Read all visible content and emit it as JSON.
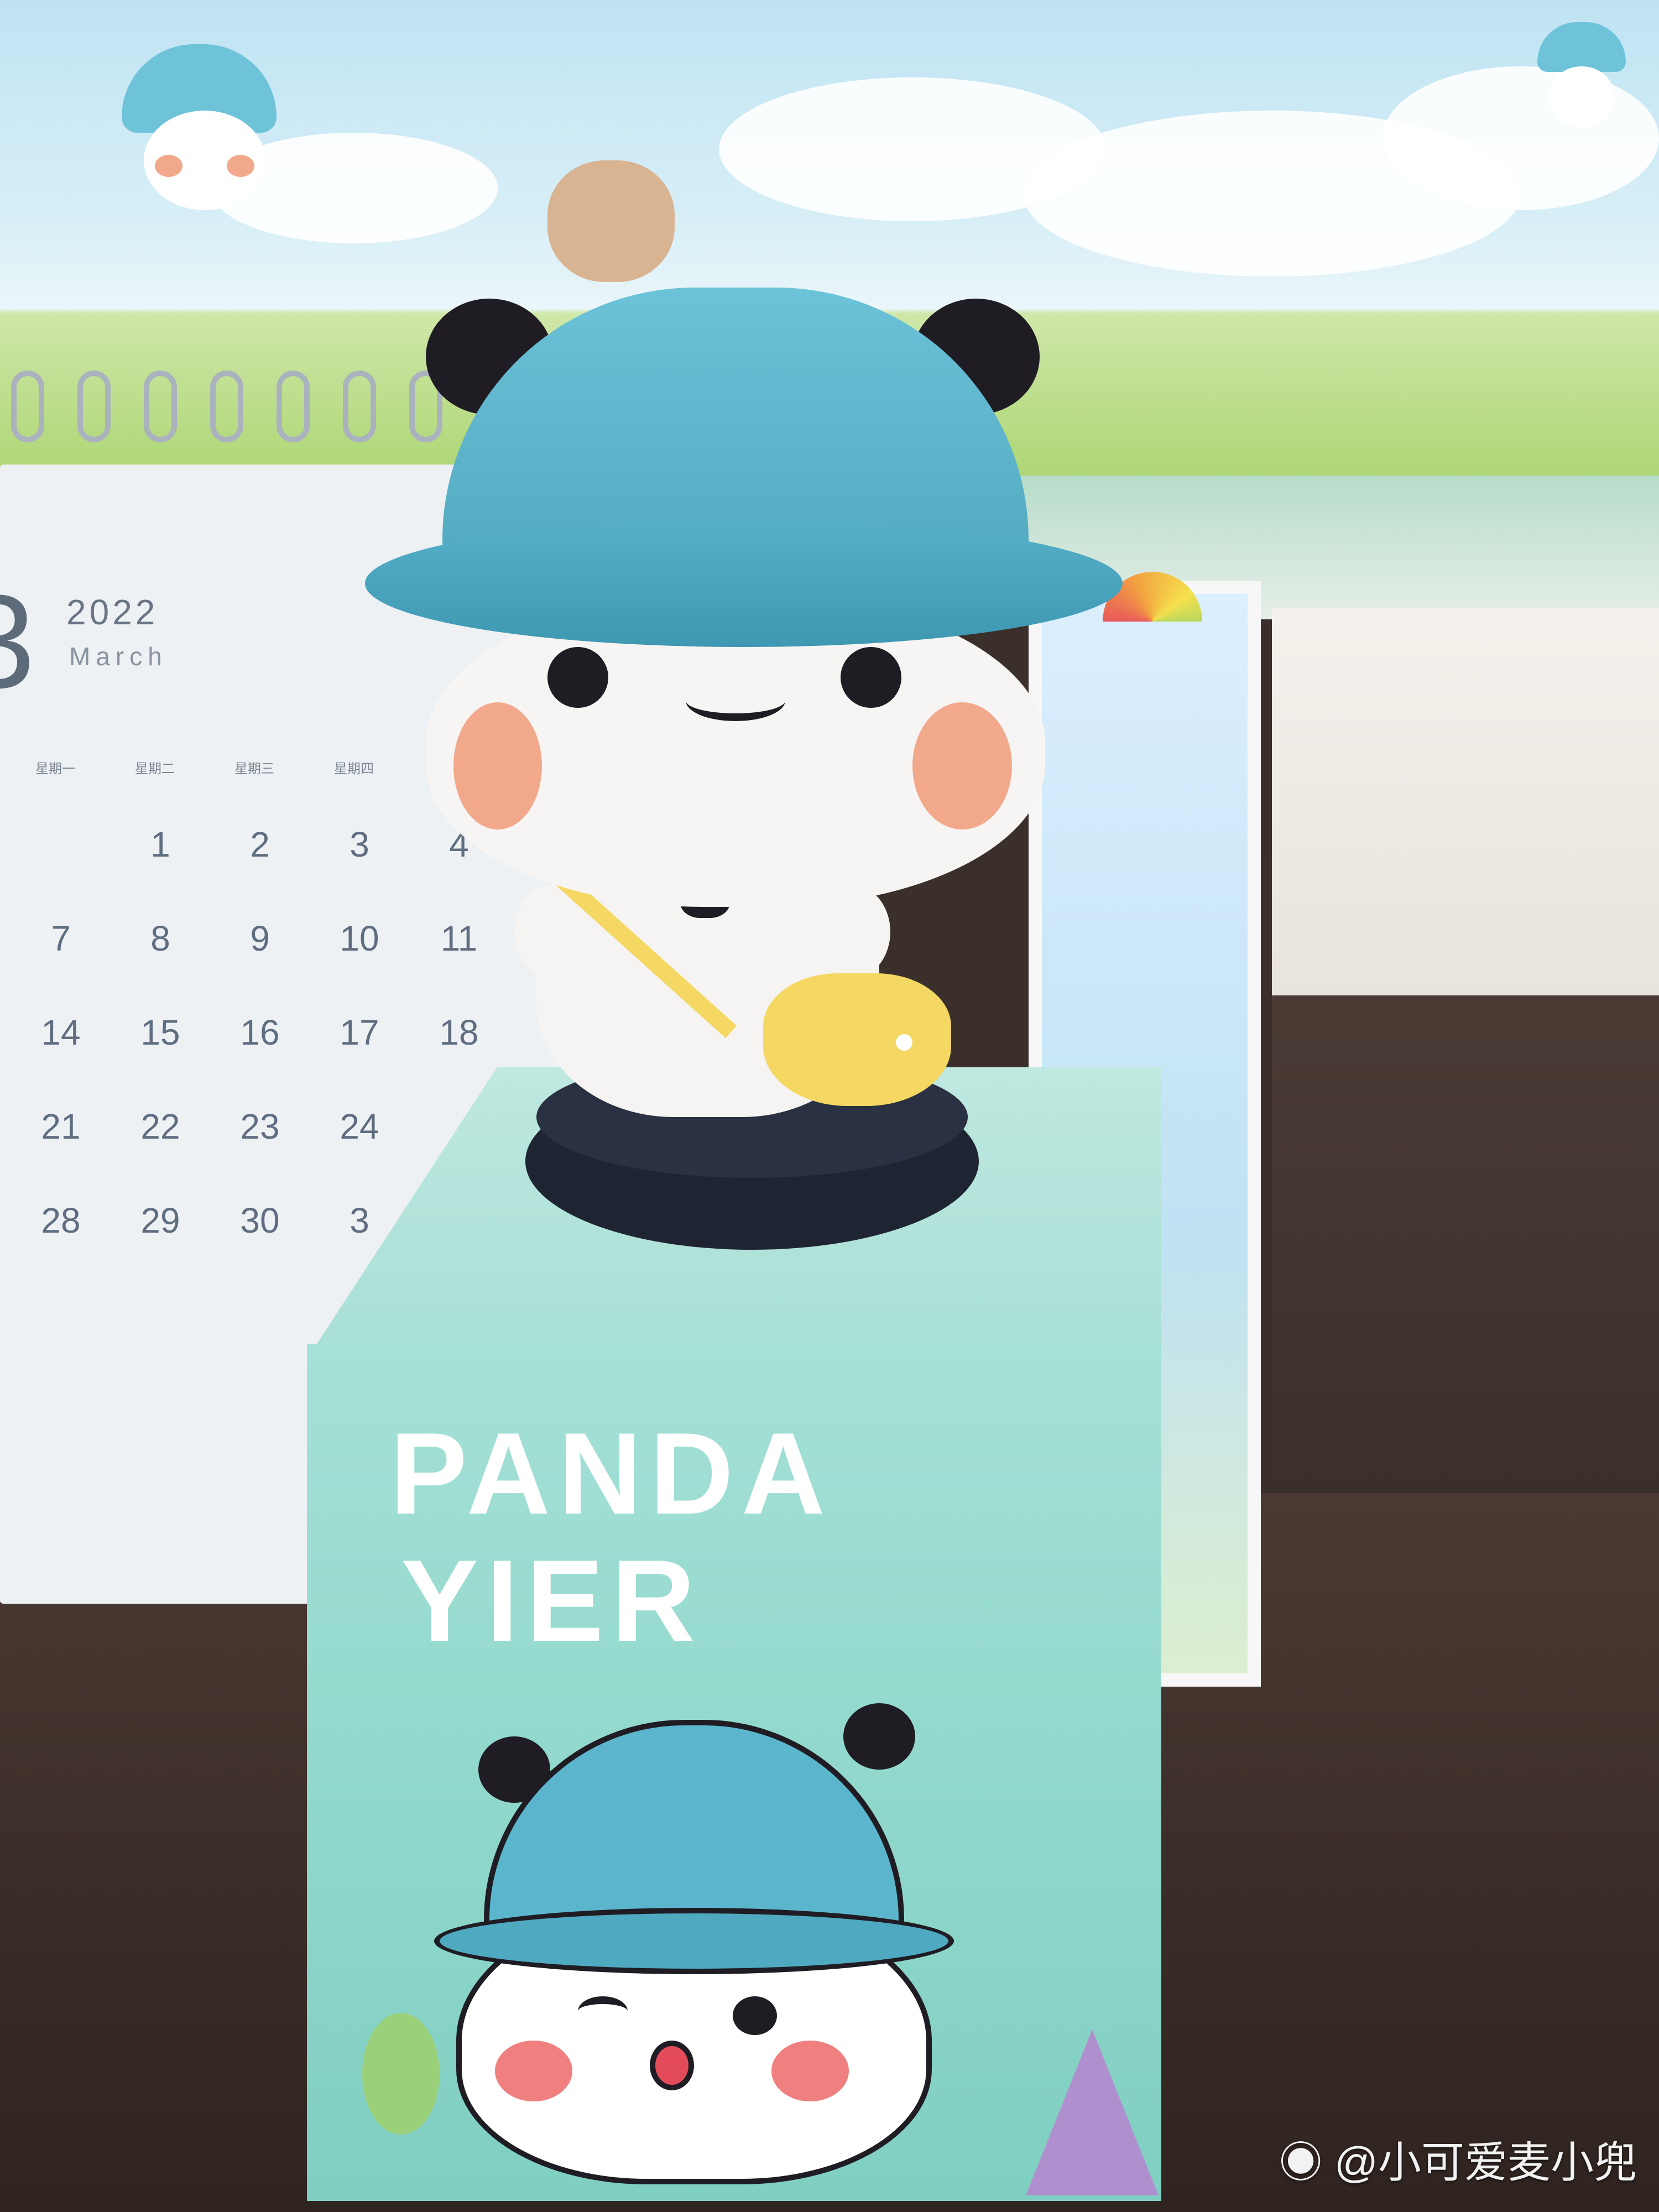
{
  "calendar": {
    "big_digit": "3",
    "year": "2022",
    "month": "March",
    "weekdays": [
      "星期一",
      "星期二",
      "星期三",
      "星期四"
    ],
    "rows": [
      [
        "",
        "1",
        "2",
        "3",
        "4"
      ],
      [
        "7",
        "8",
        "9",
        "10",
        "11"
      ],
      [
        "14",
        "15",
        "16",
        "17",
        "18"
      ],
      [
        "21",
        "22",
        "23",
        "24",
        ""
      ],
      [
        "28",
        "29",
        "30",
        "3",
        ""
      ]
    ]
  },
  "box": {
    "brand_line1": "PANDA",
    "brand_line2": "YIER"
  },
  "watermark": {
    "handle": "@小可爱麦小兜"
  },
  "colors": {
    "hat": "#5bb6cd",
    "box": "#9fdcd2",
    "bag": "#f5d764",
    "base": "#1f2432"
  }
}
